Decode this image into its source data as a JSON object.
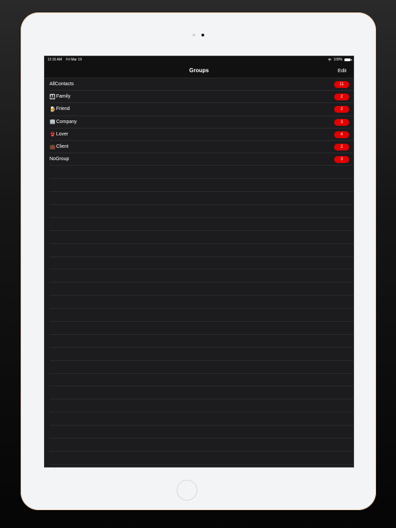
{
  "status_bar": {
    "time": "12:16 AM",
    "date": "Fri Mar 19",
    "battery": "100%"
  },
  "nav": {
    "title": "Groups",
    "edit_label": "Edit"
  },
  "groups": [
    {
      "emoji": "",
      "label": "AllContacts",
      "count": "11"
    },
    {
      "emoji": "👨‍👩‍👧",
      "label": "Family",
      "count": "2"
    },
    {
      "emoji": "🍺",
      "label": "Friend",
      "count": "2"
    },
    {
      "emoji": "🏢",
      "label": "Company",
      "count": "3"
    },
    {
      "emoji": "👙",
      "label": "Lover",
      "count": "4"
    },
    {
      "emoji": "💼",
      "label": "Client",
      "count": "2"
    },
    {
      "emoji": "",
      "label": "NoGroup",
      "count": "3"
    }
  ],
  "colors": {
    "badge": "#e20000",
    "screen_bg": "#1c1c1e",
    "bar_bg": "#111111"
  },
  "icons": {
    "wifi": "wifi-icon",
    "battery": "battery-icon"
  }
}
